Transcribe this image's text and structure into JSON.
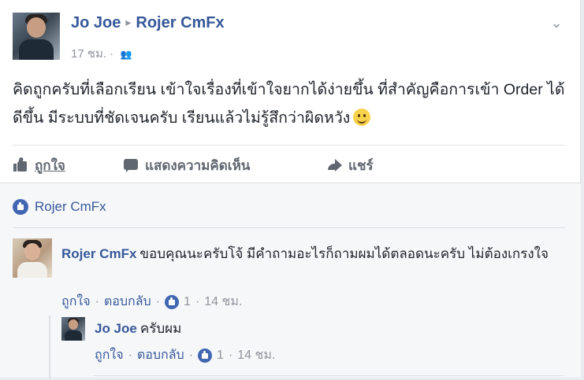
{
  "post": {
    "author": "Jo Joe",
    "target": "Rojer CmFx",
    "separator": "▸",
    "time": "17 ชม.",
    "meta_dot": "·",
    "audience_icon": "friends-icon",
    "text": "คิดถูกครับที่เลือกเรียน เข้าใจเรื่องที่เข้าใจยากได้ง่ายขึ้น ที่สำคัญคือการเข้า Order ได้ดีขึ้น มีระบบที่ชัดเจนครับ เรียนแล้วไม่รู้สึกว่าผิดหวัง",
    "emoji": "smile-emoji"
  },
  "actions": {
    "like": "ถูกใจ",
    "comment": "แสดงความคิดเห็น",
    "share": "แชร์"
  },
  "likes": {
    "name": "Rojer CmFx"
  },
  "comments": [
    {
      "author": "Rojer CmFx",
      "text": "ขอบคุณนะครับโจ้ มีคำถามอะไรก็ถามผมได้ตลอดนะครับ ไม่ต้องเกรงใจ",
      "like_label": "ถูกใจ",
      "reply_label": "ตอบกลับ",
      "like_count": "1",
      "time": "14 ชม.",
      "dot": "·"
    },
    {
      "author": "Jo Joe",
      "text": "ครับผม",
      "like_label": "ถูกใจ",
      "reply_label": "ตอบกลับ",
      "like_count": "1",
      "time": "14 ชม.",
      "dot": "·"
    }
  ],
  "colors": {
    "link": "#365899",
    "muted": "#90949c",
    "like_badge": "#4267b2",
    "comments_bg": "#f6f7f9"
  }
}
